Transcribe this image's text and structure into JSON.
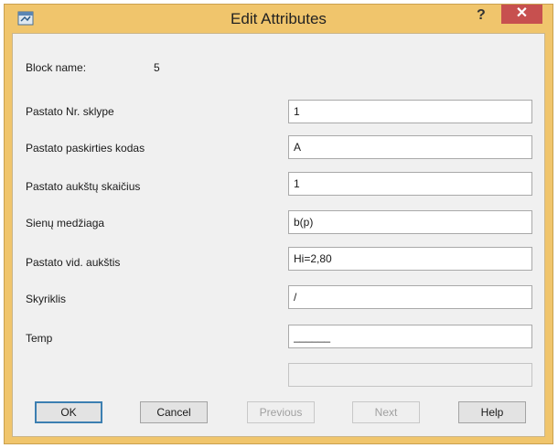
{
  "window": {
    "title": "Edit Attributes",
    "help_label": "?",
    "close_label": "✕",
    "frame_color": "#f0c56c"
  },
  "block": {
    "name_label": "Block name:",
    "name_value": "5"
  },
  "attributes": [
    {
      "label": "Pastato Nr. sklype",
      "value": "1"
    },
    {
      "label": "Pastato paskirties kodas",
      "value": "A"
    },
    {
      "label": "Pastato aukštų skaičius",
      "value": "1"
    },
    {
      "label": "Sienų medžiaga",
      "value": "b(p)"
    },
    {
      "label": "Pastato vid. aukštis",
      "value": "Hi=2,80"
    },
    {
      "label": "Skyriklis",
      "value": "/"
    },
    {
      "label": "Temp",
      "value": "______"
    }
  ],
  "buttons": {
    "ok": "OK",
    "cancel": "Cancel",
    "previous": "Previous",
    "next": "Next",
    "help": "Help"
  }
}
